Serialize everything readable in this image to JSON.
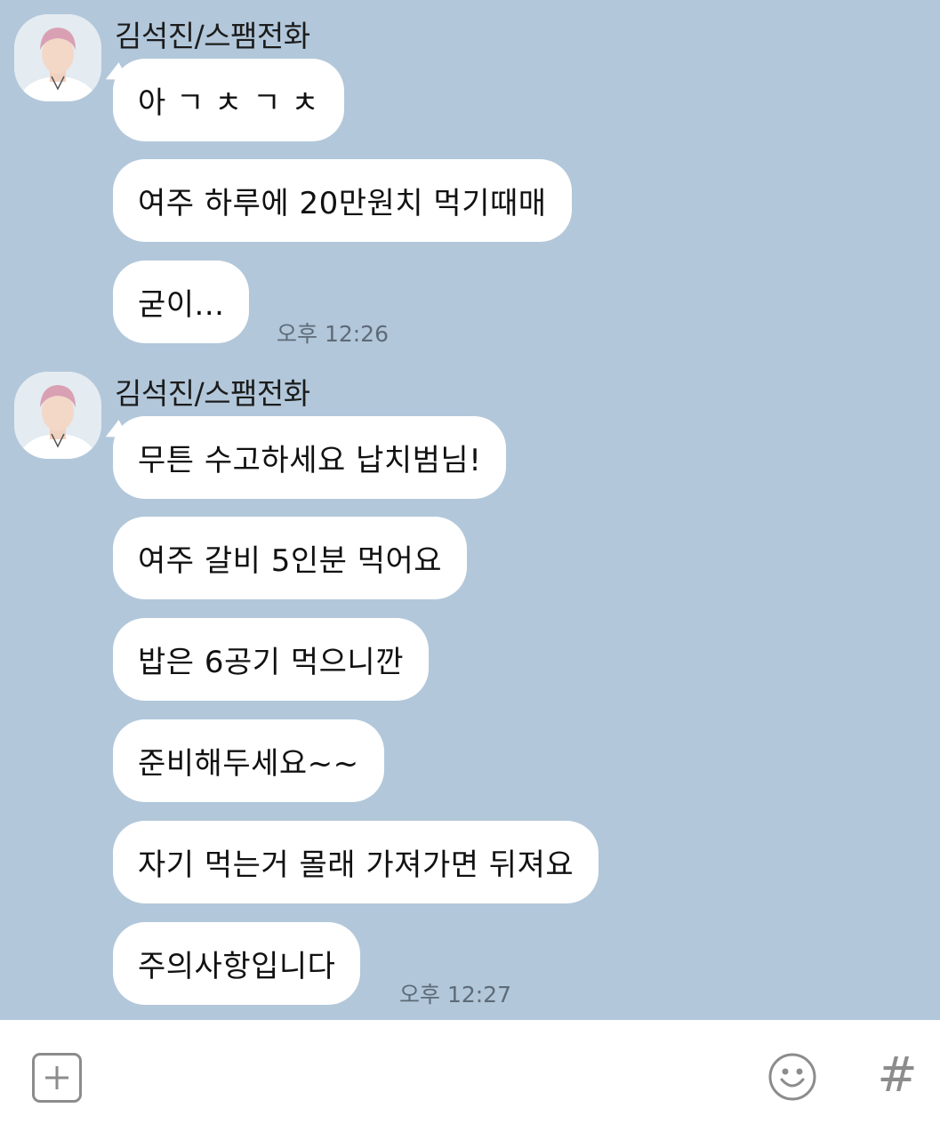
{
  "groups": [
    {
      "sender": "김석진/스팸전화",
      "messages": [
        "아 ㄱ ㅊ ㄱ ㅊ",
        "여주 하루에 20만원치 먹기때매",
        "굳이..."
      ],
      "time": "오후 12:26"
    },
    {
      "sender": "김석진/스팸전화",
      "messages": [
        "무튼 수고하세요 납치범님!",
        "여주 갈비 5인분 먹어요",
        "밥은 6공기 먹으니깐",
        "준비해두세요~~",
        "자기 먹는거 몰래 가져가면 뒤져요",
        "주의사항입니다"
      ],
      "time": "오후 12:27"
    }
  ],
  "input_bar": {
    "plus_icon": "plus-square-icon",
    "emoji_icon": "smiley-icon",
    "hash_label": "#"
  },
  "colors": {
    "chat_background": "#b2c7da",
    "bubble": "#ffffff",
    "timestamp": "#5e6b78",
    "input_bar": "#ffffff"
  }
}
